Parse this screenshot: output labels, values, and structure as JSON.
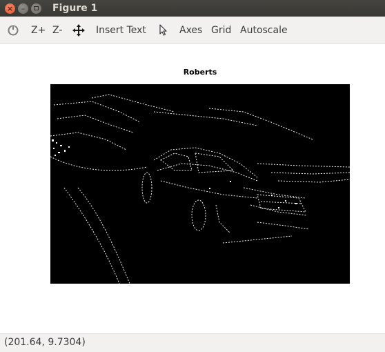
{
  "window": {
    "title": "Figure 1",
    "close_glyph": "×",
    "min_glyph": "–"
  },
  "toolbar": {
    "home_icon": "home-icon",
    "zoom_in_label": "Z+",
    "zoom_out_label": "Z-",
    "pan_icon": "pan-arrows-icon",
    "insert_text_label": "Insert Text",
    "pointer_icon": "cursor-icon",
    "axes_label": "Axes",
    "grid_label": "Grid",
    "autoscale_label": "Autoscale"
  },
  "figure": {
    "plot_title": "Roberts",
    "image_description": "edge-detection image",
    "background_color": "#000000",
    "edge_color": "#ffffff"
  },
  "status": {
    "coordinates": "(201.64, 9.7304)"
  }
}
